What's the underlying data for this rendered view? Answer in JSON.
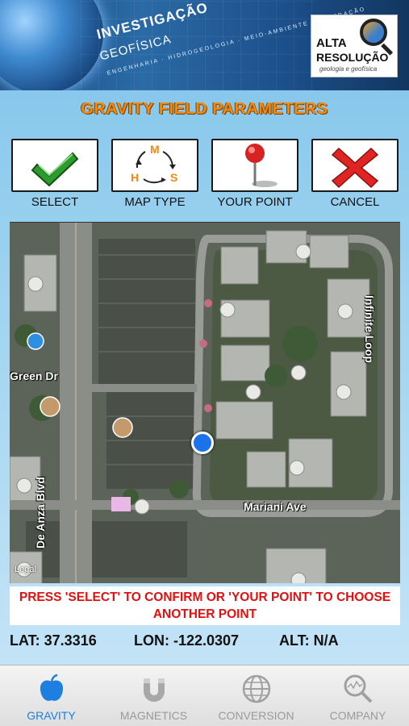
{
  "header": {
    "title_line1": "INVESTIGAÇÃO",
    "title_line2": "GEOFÍSICA",
    "subtitle": "ENGENHARIA · HIDROGEOLOGIA · MEIO-AMBIENTE · MINERAÇÃO",
    "brand_line1": "ALTA",
    "brand_line2": "RESOLUÇÃO",
    "brand_tagline": "geologia e geofísica"
  },
  "page_title": "GRAVITY FIELD PARAMETERS",
  "toolbar": {
    "select_label": "SELECT",
    "map_type_label": "MAP TYPE",
    "your_point_label": "YOUR POINT",
    "cancel_label": "CANCEL",
    "map_type_letters": [
      "M",
      "S",
      "H"
    ]
  },
  "map": {
    "street_labels": [
      "Green Dr",
      "De Anza Blvd",
      "Infinite Loop",
      "Mariani Ave"
    ],
    "legal_label": "Legal"
  },
  "instruction": "PRESS 'SELECT' TO CONFIRM OR 'YOUR POINT' TO CHOOSE ANOTHER POINT",
  "coordinates": {
    "lat": "LAT: 37.3316",
    "lon": "LON: -122.0307",
    "alt": "ALT: N/A"
  },
  "tabs": [
    {
      "label": "GRAVITY",
      "icon": "apple-icon",
      "active": true
    },
    {
      "label": "MAGNETICS",
      "icon": "magnet-icon",
      "active": false
    },
    {
      "label": "CONVERSION",
      "icon": "globe-icon",
      "active": false
    },
    {
      "label": "COMPANY",
      "icon": "magnifier-icon",
      "active": false
    }
  ],
  "colors": {
    "title_orange": "#f28a12",
    "instruction_red": "#e21010",
    "tab_active": "#1f7fe0",
    "location_dot": "#1a73e8"
  }
}
